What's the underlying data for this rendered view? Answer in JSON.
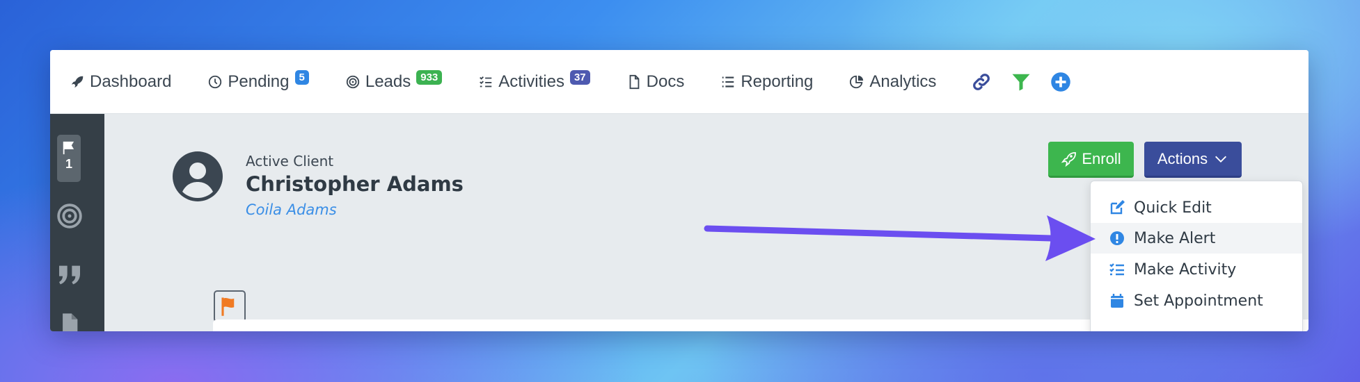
{
  "nav": {
    "dashboard": "Dashboard",
    "pending": "Pending",
    "pending_count": "5",
    "leads": "Leads",
    "leads_count": "933",
    "activities": "Activities",
    "activities_count": "37",
    "docs": "Docs",
    "reporting": "Reporting",
    "analytics": "Analytics",
    "icons": [
      "link-icon",
      "filter-icon",
      "plus-circle-icon"
    ]
  },
  "sidebar": {
    "flag_count": "1",
    "icons": [
      "flag-icon",
      "target-icon",
      "quote-icon",
      "file-icon"
    ]
  },
  "client": {
    "status": "Active Client",
    "name": "Christopher Adams",
    "secondary_name": "Coila Adams"
  },
  "buttons": {
    "enroll": "Enroll",
    "actions": "Actions"
  },
  "actions_menu": [
    {
      "label": "Quick Edit",
      "icon": "edit-icon"
    },
    {
      "label": "Make Alert",
      "icon": "alert-circle-icon"
    },
    {
      "label": "Make Activity",
      "icon": "tasks-icon"
    },
    {
      "label": "Set Appointment",
      "icon": "calendar-icon"
    }
  ],
  "colors": {
    "green": "#3db64e",
    "navy": "#3a4d9b",
    "blue": "#3a8ee6",
    "badge_blue": "#2f86e3",
    "badge_green": "#3cb251",
    "badge_indigo": "#4e5ab0",
    "annotation_arrow": "#6b4ef0",
    "sidebar": "#353f47"
  }
}
